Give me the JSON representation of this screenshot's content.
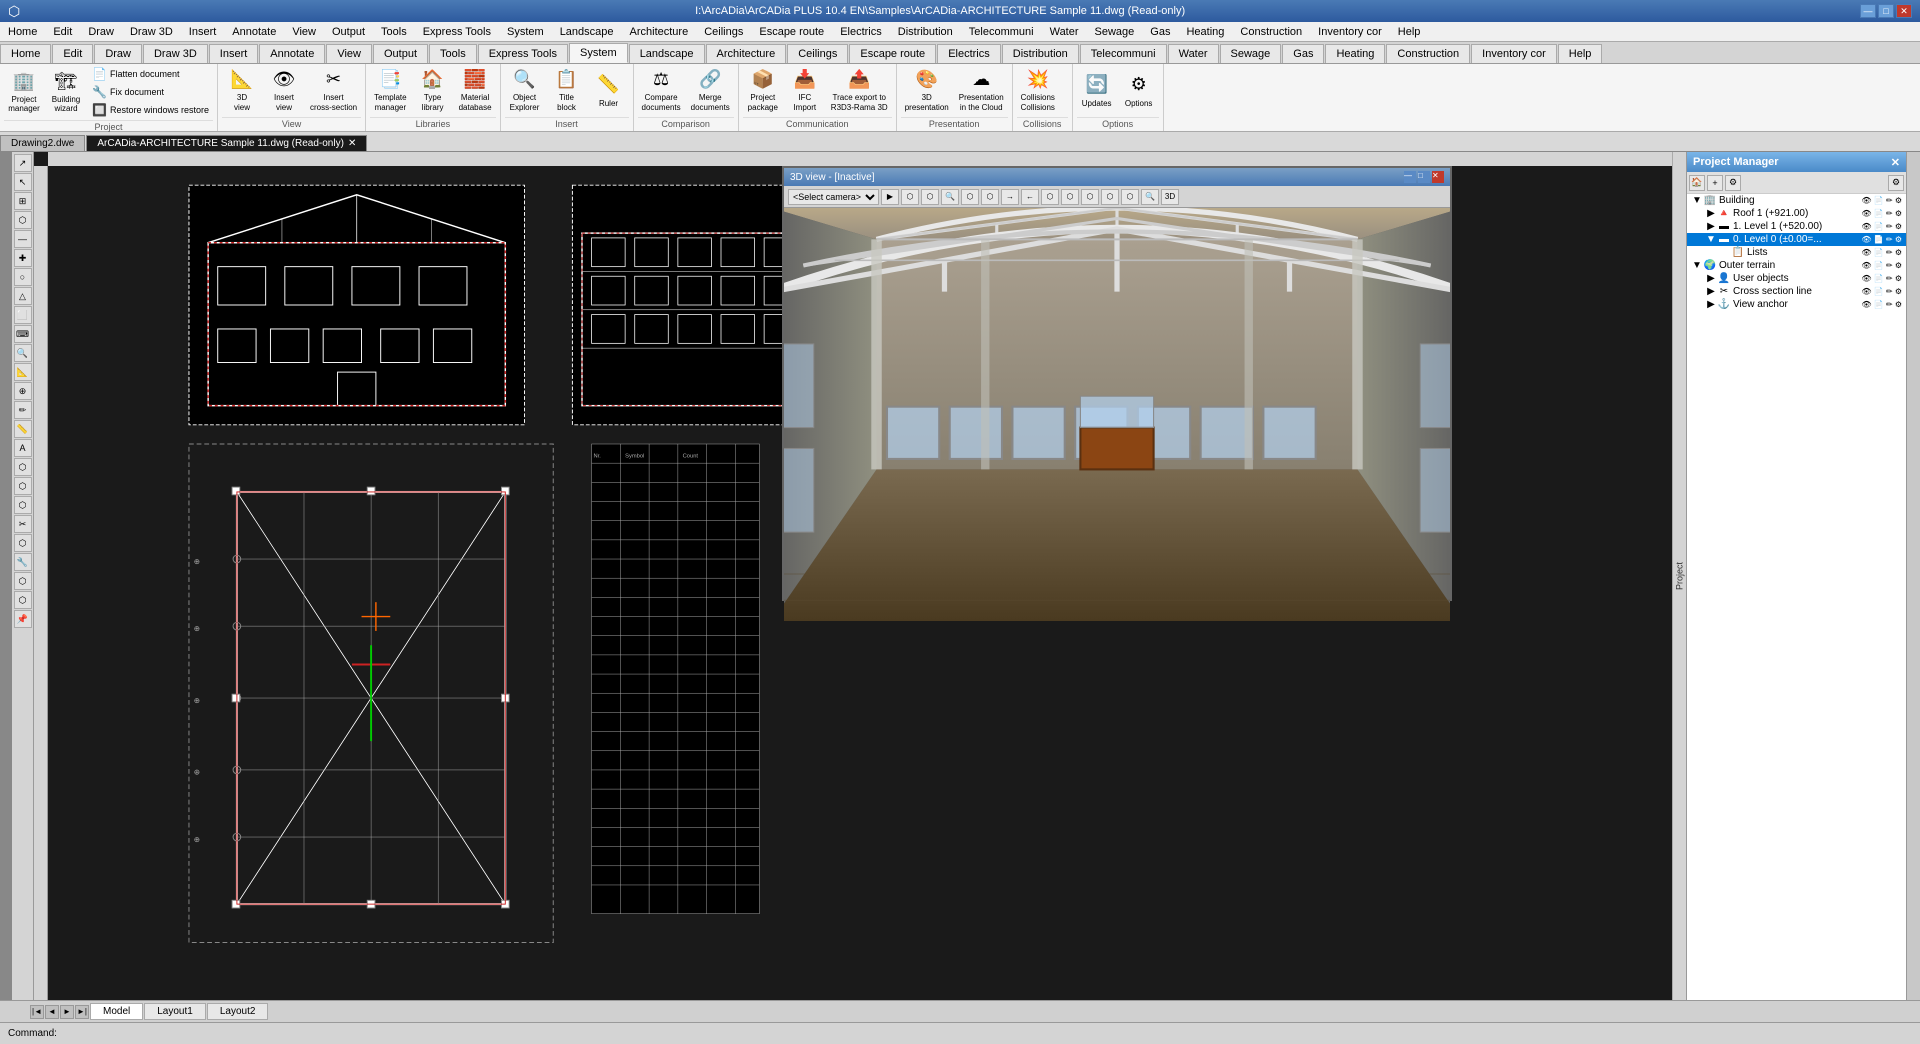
{
  "titlebar": {
    "title": "I:\\ArcADia\\ArCADia PLUS 10.4 EN\\Samples\\ArCADia-ARCHITECTURE Sample 11.dwg (Read-only)",
    "app_icon": "⬡",
    "win_controls": [
      "—",
      "□",
      "✕"
    ]
  },
  "menubar": {
    "items": [
      "Home",
      "Edit",
      "Draw",
      "Draw 3D",
      "Insert",
      "Annotate",
      "View",
      "Output",
      "Tools",
      "Express Tools",
      "System",
      "Landscape",
      "Architecture",
      "Ceilings",
      "Escape route",
      "Electrics",
      "Distribution",
      "Telecommuni",
      "Water",
      "Sewage",
      "Gas",
      "Heating",
      "Construction",
      "Inventory cor",
      "Help"
    ]
  },
  "ribbon": {
    "active_tab": "System",
    "groups": [
      {
        "label": "Project",
        "buttons": [
          {
            "icon": "🏢",
            "label": "Project\nmanager",
            "small_buttons": []
          },
          {
            "icon": "🏗",
            "label": "Building\nwizard",
            "small_buttons": [
              {
                "icon": "📄",
                "label": "Flatten document"
              },
              {
                "icon": "🔧",
                "label": "Fix document"
              },
              {
                "icon": "🔲",
                "label": "Restore windows restore"
              }
            ]
          }
        ]
      },
      {
        "label": "View",
        "buttons": [
          {
            "icon": "📐",
            "label": "3D\nview"
          },
          {
            "icon": "👁",
            "label": "Insert\nview"
          },
          {
            "icon": "✂",
            "label": "Insert\ncross-section"
          }
        ]
      },
      {
        "label": "Libraries",
        "buttons": [
          {
            "icon": "📑",
            "label": "Template\nmanager"
          },
          {
            "icon": "🏠",
            "label": "Type\nlibrary"
          },
          {
            "icon": "🧱",
            "label": "Material\ndatabase"
          }
        ]
      },
      {
        "label": "Insert",
        "buttons": [
          {
            "icon": "🔍",
            "label": "Object\nExplorer"
          },
          {
            "icon": "📋",
            "label": "Title\nblock"
          },
          {
            "icon": "📏",
            "label": "Ruler"
          }
        ]
      },
      {
        "label": "Comparison",
        "buttons": [
          {
            "icon": "⚖",
            "label": "Compare\ndocuments"
          },
          {
            "icon": "🔗",
            "label": "Merge\ndocuments"
          }
        ]
      },
      {
        "label": "Communication",
        "buttons": [
          {
            "icon": "📦",
            "label": "Project\npackage"
          },
          {
            "icon": "📥",
            "label": "IFC\nImport"
          },
          {
            "icon": "📤",
            "label": "Trace export to\nR3D3-Rama 3D"
          }
        ]
      },
      {
        "label": "Presentation",
        "buttons": [
          {
            "icon": "🎨",
            "label": "3D\npresentation"
          },
          {
            "icon": "☁",
            "label": "Presentation\nin the Cloud"
          }
        ]
      },
      {
        "label": "Collisions",
        "buttons": [
          {
            "icon": "💥",
            "label": "Collisions"
          }
        ]
      },
      {
        "label": "Options",
        "buttons": [
          {
            "icon": "🔄",
            "label": "Updates"
          },
          {
            "icon": "⚙",
            "label": "Options"
          }
        ]
      }
    ]
  },
  "tabs": {
    "items": [
      {
        "label": "Drawing2.dwe",
        "active": false,
        "closable": false
      },
      {
        "label": "ArCADia-ARCHITECTURE Sample 11.dwg (Read-only)",
        "active": true,
        "closable": true
      }
    ]
  },
  "layout_tabs": {
    "items": [
      "Model",
      "Layout1",
      "Layout2"
    ]
  },
  "project_manager": {
    "title": "Project Manager",
    "tree": [
      {
        "level": 0,
        "expanded": true,
        "icon": "🏢",
        "label": "Building",
        "indent": 0
      },
      {
        "level": 1,
        "expanded": true,
        "icon": "🔺",
        "label": "Roof 1 (+921.00)",
        "indent": 1
      },
      {
        "level": 1,
        "expanded": false,
        "icon": "▬",
        "label": "1. Level 1 (+520.00)",
        "indent": 1,
        "selected": false
      },
      {
        "level": 1,
        "expanded": true,
        "icon": "▬",
        "label": "0. Level 0 (±0.00=...",
        "indent": 1,
        "selected": true
      },
      {
        "level": 2,
        "expanded": false,
        "icon": "📋",
        "label": "Lists",
        "indent": 2
      },
      {
        "level": 0,
        "expanded": true,
        "icon": "🌍",
        "label": "Outer terrain",
        "indent": 0
      },
      {
        "level": 1,
        "expanded": false,
        "icon": "👤",
        "label": "User objects",
        "indent": 1
      },
      {
        "level": 1,
        "expanded": false,
        "icon": "✂",
        "label": "Cross section line",
        "indent": 1
      },
      {
        "level": 1,
        "expanded": false,
        "icon": "⚓",
        "label": "View anchor",
        "indent": 1
      }
    ]
  },
  "view_3d": {
    "title": "3D view - [Inactive]",
    "camera_label": "<Select camera>"
  },
  "status_bar": {
    "command_label": "Command:"
  },
  "left_toolbar_icons": [
    "↗",
    "↖",
    "⊞",
    "⬡",
    "—",
    "✚",
    "○",
    "△",
    "⬜",
    "⌨",
    "🔍",
    "📐",
    "⊕",
    "✏",
    "📏",
    "A",
    "⬡",
    "⬡",
    "⬡",
    "✂",
    "⬡",
    "🔧",
    "⬡",
    "⬡",
    "📌"
  ],
  "colors": {
    "active_tab_bg": "#1a1a1a",
    "ribbon_active": "#f5f5f5",
    "accent_blue": "#4a7ab5",
    "cad_bg": "#1a1a1a",
    "cad_lines": "#ffffff",
    "pm_selected": "#0078d7"
  }
}
